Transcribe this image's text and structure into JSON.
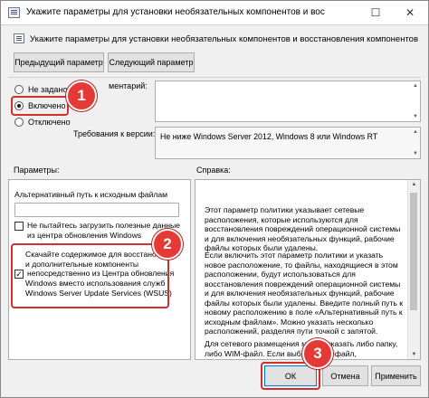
{
  "window": {
    "title": "Укажите параметры для установки необязательных компонентов и восстановления компо",
    "maximize_glyph": "☐",
    "close_glyph": "✕"
  },
  "header": {
    "text": "Укажите параметры для установки необязательных компонентов и восстановления компонентов"
  },
  "nav": {
    "prev_label": "Предыдущий параметр",
    "next_label": "Следующий параметр"
  },
  "state": {
    "options": [
      {
        "label": "Не задано",
        "checked": false
      },
      {
        "label": "Включено",
        "checked": true
      },
      {
        "label": "Отключено",
        "checked": false
      }
    ]
  },
  "comment": {
    "label": "ментарий:",
    "value": ""
  },
  "requirements": {
    "label": "Требования к версии:",
    "value": "Не ниже Windows Server 2012, Windows 8 или Windows RT"
  },
  "params": {
    "section_label": "Параметры:",
    "alt_path_label": "Альтернативный путь к исходным файлам",
    "alt_path_value": "",
    "checkbox1_label": "Не пытайтесь загрузить полезные данные из центра обновления Windows",
    "checkbox2_text_top": "Скачайте содержимое для восстановлен",
    "checkbox2_text_2": "и дополнительные компоненты",
    "checkbox2_text_3": "непосредственно из Центра обновления",
    "checkbox2_text_4": "Windows вместо использования служб",
    "checkbox2_text_5": "Windows Server Update Services (WSUS)"
  },
  "help": {
    "section_label": "Справка:",
    "paragraphs": [
      "Этот параметр политики указывает сетевые расположения, которые используются для восстановления повреждений операционной системы и для включения необязательных функций, рабочие файлы которых были удалены.",
      "Если включить этот параметр политики и указать новое расположение, то файлы, находящиеся в этом расположении, будут использоваться для восстановления повреждений операционной системы и для включения необязательных функций, рабочие файлы которых были удалены. Введите полный путь к новому расположению в поле «Альтернативный путь к исходным файлам». Можно указать несколько расположений, разделяя пути точкой с запятой.",
      "Для сетевого размещения можно указать либо папку, либо WIM-файл. Если выбран WIM-файл, расположение"
    ]
  },
  "footer": {
    "ok_label": "ОК",
    "cancel_label": "Отмена",
    "apply_label": "Применить"
  },
  "callouts": {
    "badge1": "1",
    "badge2": "2",
    "badge3": "3",
    "color": "#e53935"
  }
}
